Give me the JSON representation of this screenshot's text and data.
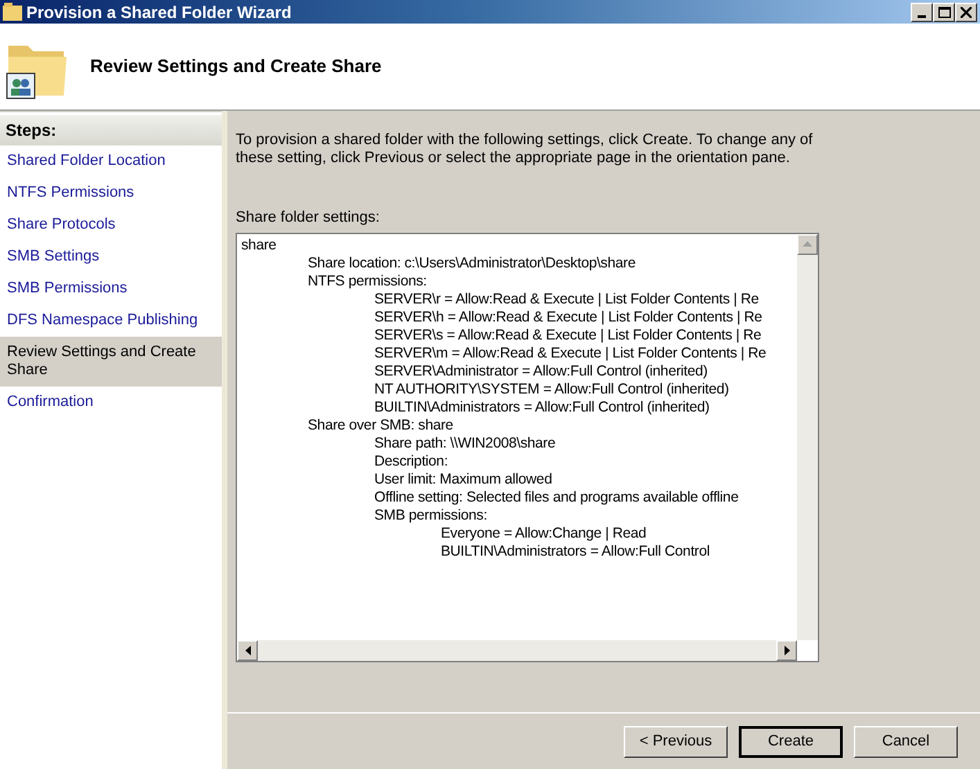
{
  "window": {
    "title": "Provision a Shared Folder Wizard"
  },
  "header": {
    "title": "Review Settings and Create Share"
  },
  "steps": {
    "title": "Steps:",
    "items": [
      {
        "label": "Shared Folder Location",
        "selected": false
      },
      {
        "label": "NTFS Permissions",
        "selected": false
      },
      {
        "label": "Share Protocols",
        "selected": false
      },
      {
        "label": "SMB Settings",
        "selected": false
      },
      {
        "label": "SMB Permissions",
        "selected": false
      },
      {
        "label": "DFS Namespace Publishing",
        "selected": false
      },
      {
        "label": "Review Settings and Create Share",
        "selected": true
      },
      {
        "label": "Confirmation",
        "selected": false
      }
    ]
  },
  "instructions": "To provision a shared folder with the following settings, click Create. To change any of these setting, click Previous or select the appropriate page in the orientation pane.",
  "settings": {
    "label": "Share folder settings:",
    "lines": [
      {
        "text": "share",
        "children": [
          {
            "text": "Share location: c:\\Users\\Administrator\\Desktop\\share"
          },
          {
            "text": "NTFS permissions:",
            "children": [
              {
                "text": "SERVER\\r = Allow:Read & Execute | List Folder Contents | Re"
              },
              {
                "text": "SERVER\\h = Allow:Read & Execute | List Folder Contents | Re"
              },
              {
                "text": "SERVER\\s = Allow:Read & Execute | List Folder Contents | Re"
              },
              {
                "text": "SERVER\\m = Allow:Read & Execute | List Folder Contents | Re"
              },
              {
                "text": "SERVER\\Administrator = Allow:Full Control (inherited)"
              },
              {
                "text": "NT AUTHORITY\\SYSTEM = Allow:Full Control (inherited)"
              },
              {
                "text": "BUILTIN\\Administrators = Allow:Full Control (inherited)"
              }
            ]
          },
          {
            "text": "Share over SMB: share",
            "children": [
              {
                "text": "Share path: \\\\WIN2008\\share"
              },
              {
                "text": "Description:"
              },
              {
                "text": "User limit: Maximum allowed"
              },
              {
                "text": "Offline setting: Selected files and programs available offline"
              },
              {
                "text": "SMB permissions:",
                "children": [
                  {
                    "text": "Everyone = Allow:Change | Read"
                  },
                  {
                    "text": "BUILTIN\\Administrators = Allow:Full Control"
                  }
                ]
              }
            ]
          }
        ]
      }
    ]
  },
  "buttons": [
    {
      "label": "< Previous",
      "default": false
    },
    {
      "label": "Create",
      "default": true
    },
    {
      "label": "Cancel",
      "default": false
    }
  ]
}
